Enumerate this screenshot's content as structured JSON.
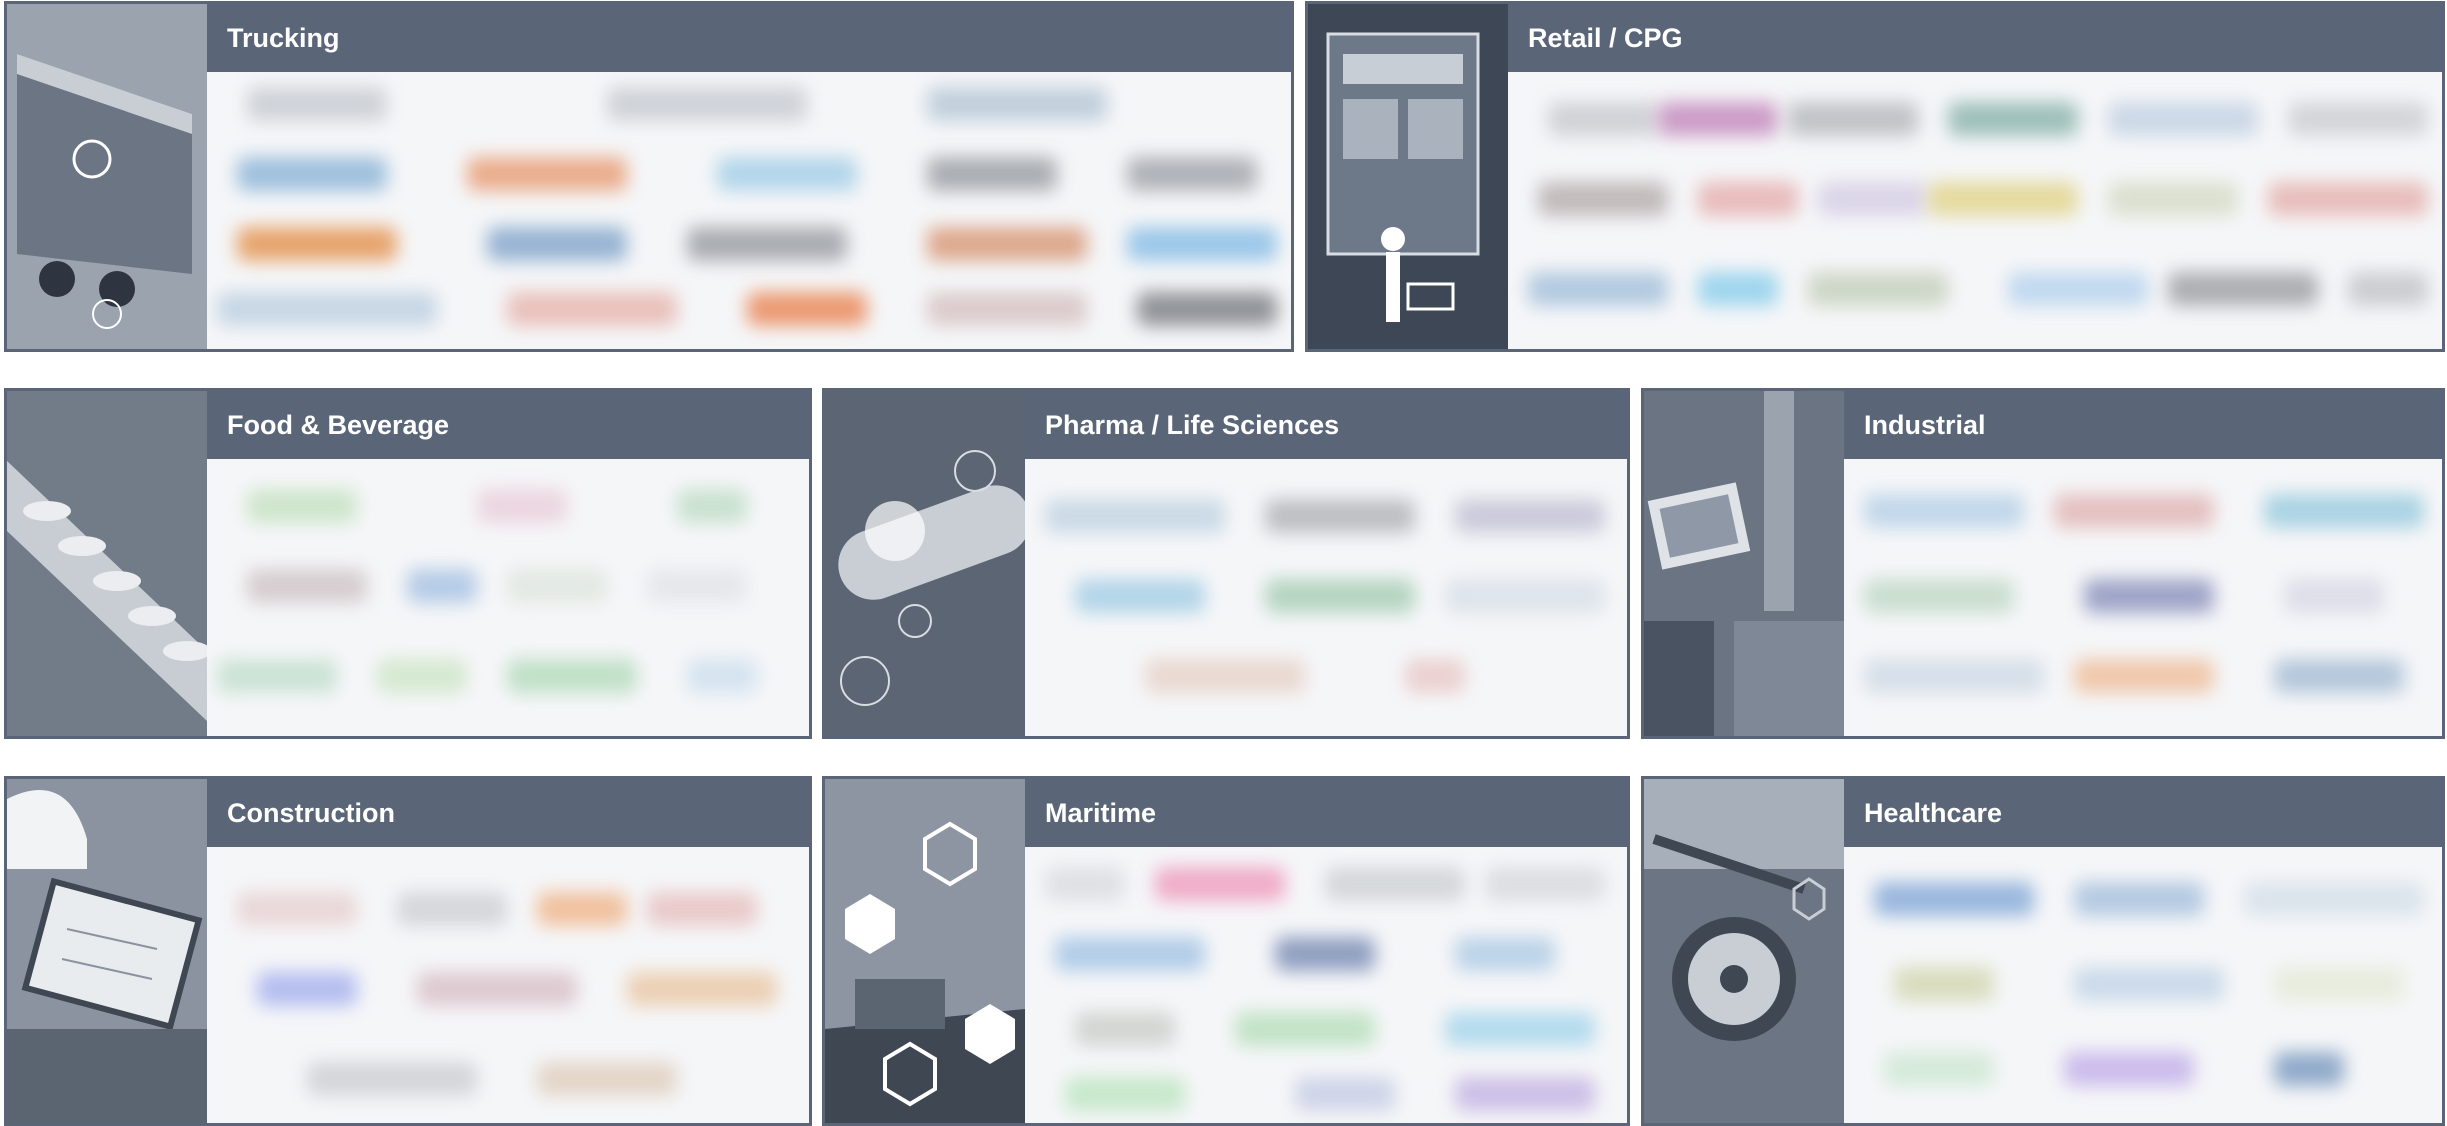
{
  "industries": [
    {
      "id": "trucking",
      "title": "Trucking",
      "thumb_icon": "truck-icon",
      "accent": "#5a6677"
    },
    {
      "id": "retail-cpg",
      "title": "Retail / CPG",
      "thumb_icon": "shopping-cart-icon",
      "accent": "#5a6677"
    },
    {
      "id": "food-beverage",
      "title": "Food & Beverage",
      "thumb_icon": "conveyor-icon",
      "accent": "#5a6677"
    },
    {
      "id": "pharma-life-sciences",
      "title": "Pharma / Life Sciences",
      "thumb_icon": "capsule-icon",
      "accent": "#5a6677"
    },
    {
      "id": "industrial",
      "title": "Industrial",
      "thumb_icon": "factory-icon",
      "accent": "#5a6677"
    },
    {
      "id": "construction",
      "title": "Construction",
      "thumb_icon": "hardhat-icon",
      "accent": "#5a6677"
    },
    {
      "id": "maritime",
      "title": "Maritime",
      "thumb_icon": "ship-icon",
      "accent": "#5a6677"
    },
    {
      "id": "healthcare",
      "title": "Healthcare",
      "thumb_icon": "stethoscope-icon",
      "accent": "#5a6677"
    }
  ]
}
